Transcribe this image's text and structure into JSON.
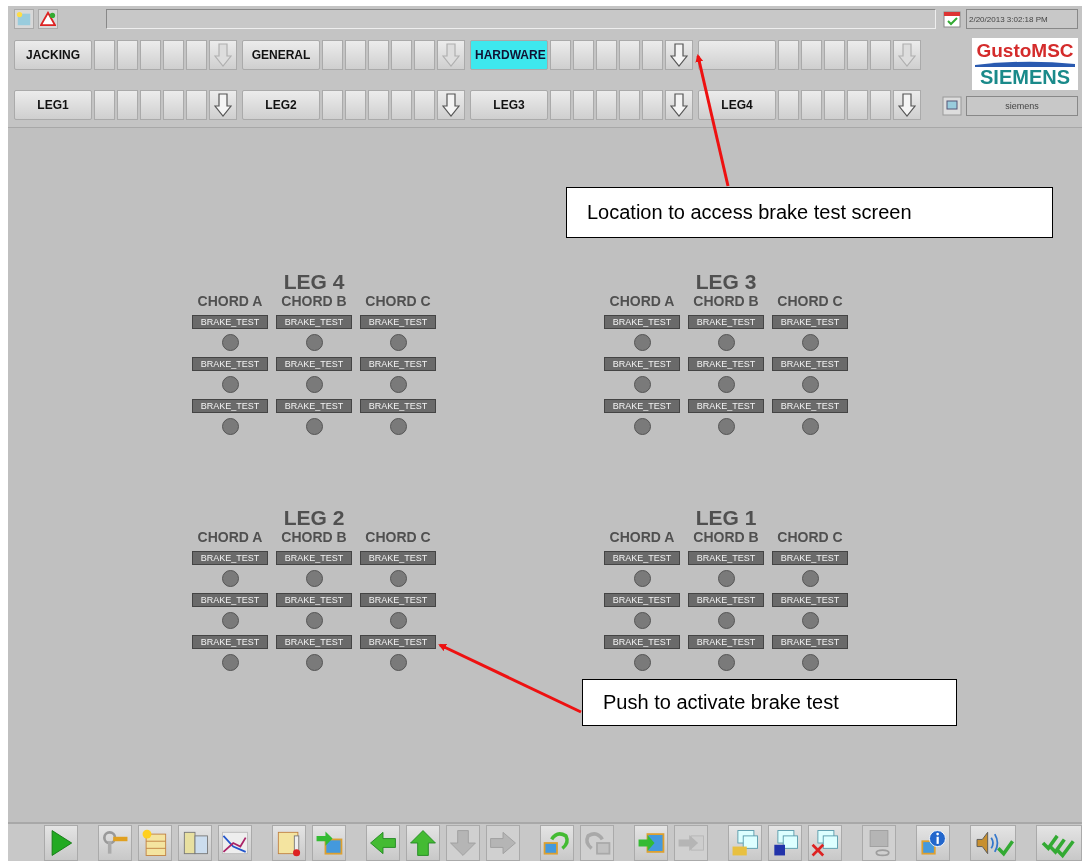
{
  "header": {
    "date_time": "2/20/2013 3:02:18 PM",
    "user": "siemens",
    "logo": {
      "line_1": "GustoMSC",
      "line_2": "SIEMENS"
    }
  },
  "menu_rows": [
    {
      "groups": [
        {
          "label": "JACKING",
          "selected": false,
          "arrow_disabled": true
        },
        {
          "label": "GENERAL",
          "selected": false,
          "arrow_disabled": true
        },
        {
          "label": "HARDWARE",
          "selected": true,
          "arrow_disabled": false
        },
        {
          "selected": false,
          "arrow_disabled": true
        }
      ]
    },
    {
      "groups": [
        {
          "label": "LEG1",
          "selected": false,
          "arrow_disabled": false
        },
        {
          "label": "LEG2",
          "selected": false,
          "arrow_disabled": false
        },
        {
          "label": "LEG3",
          "selected": false,
          "arrow_disabled": false
        },
        {
          "label": "LEG4",
          "selected": false,
          "arrow_disabled": false
        }
      ]
    }
  ],
  "legs": [
    {
      "title": "LEG 4",
      "chords": [
        {
          "name": "CHORD A",
          "buttons": [
            "BRAKE_TEST",
            "BRAKE_TEST",
            "BRAKE_TEST"
          ]
        },
        {
          "name": "CHORD B",
          "buttons": [
            "BRAKE_TEST",
            "BRAKE_TEST",
            "BRAKE_TEST"
          ]
        },
        {
          "name": "CHORD C",
          "buttons": [
            "BRAKE_TEST",
            "BRAKE_TEST",
            "BRAKE_TEST"
          ]
        }
      ]
    },
    {
      "title": "LEG 3",
      "chords": [
        {
          "name": "CHORD A",
          "buttons": [
            "BRAKE_TEST",
            "BRAKE_TEST",
            "BRAKE_TEST"
          ]
        },
        {
          "name": "CHORD B",
          "buttons": [
            "BRAKE_TEST",
            "BRAKE_TEST",
            "BRAKE_TEST"
          ]
        },
        {
          "name": "CHORD C",
          "buttons": [
            "BRAKE_TEST",
            "BRAKE_TEST",
            "BRAKE_TEST"
          ]
        }
      ]
    },
    {
      "title": "LEG 2",
      "chords": [
        {
          "name": "CHORD A",
          "buttons": [
            "BRAKE_TEST",
            "BRAKE_TEST",
            "BRAKE_TEST"
          ]
        },
        {
          "name": "CHORD B",
          "buttons": [
            "BRAKE_TEST",
            "BRAKE_TEST",
            "BRAKE_TEST"
          ]
        },
        {
          "name": "CHORD C",
          "buttons": [
            "BRAKE_TEST",
            "BRAKE_TEST",
            "BRAKE_TEST"
          ]
        }
      ]
    },
    {
      "title": "LEG 1",
      "chords": [
        {
          "name": "CHORD A",
          "buttons": [
            "BRAKE_TEST",
            "BRAKE_TEST",
            "BRAKE_TEST"
          ]
        },
        {
          "name": "CHORD B",
          "buttons": [
            "BRAKE_TEST",
            "BRAKE_TEST",
            "BRAKE_TEST"
          ]
        },
        {
          "name": "CHORD C",
          "buttons": [
            "BRAKE_TEST",
            "BRAKE_TEST",
            "BRAKE_TEST"
          ]
        }
      ]
    }
  ],
  "toolbar": [
    {
      "disabled": false
    },
    {
      "disabled": false
    },
    {
      "disabled": false
    },
    {
      "disabled": false
    },
    {
      "disabled": false
    },
    {
      "disabled": false
    },
    {
      "disabled": false
    },
    {
      "disabled": false
    },
    {
      "disabled": false
    },
    {
      "disabled": true
    },
    {
      "disabled": true
    },
    {
      "disabled": false
    },
    {
      "disabled": true
    },
    {
      "disabled": false
    },
    {
      "disabled": true
    },
    {
      "disabled": false
    },
    {
      "disabled": false
    },
    {
      "disabled": false
    },
    {
      "disabled": true
    },
    {
      "disabled": false
    },
    {
      "disabled": false
    },
    {
      "disabled": false
    }
  ],
  "callouts": [
    {
      "text": "Location to access brake test screen"
    },
    {
      "text": "Push to activate brake test"
    }
  ]
}
